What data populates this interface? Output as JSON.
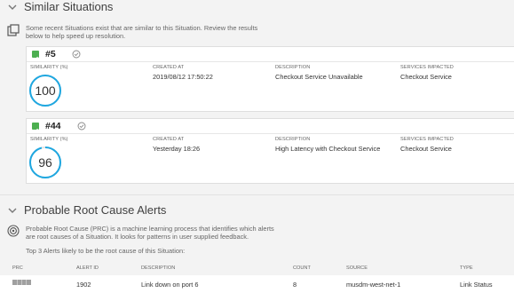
{
  "similar": {
    "title": "Similar Situations",
    "desc_line1": "Some recent Situations exist that are similar to this Situation. Review the results",
    "desc_line2": "below to help speed up resolution.",
    "columns": {
      "similarity": "SIMILARITY (%)",
      "created": "CREATED AT",
      "description": "DESCRIPTION",
      "services": "SERVICES IMPACTED"
    },
    "cards": [
      {
        "number": "#5",
        "similarity": "100",
        "similarity_fraction": 1.0,
        "created": "2019/08/12 17:50:22",
        "description": "Checkout Service Unavailable",
        "services": "Checkout Service"
      },
      {
        "number": "#44",
        "similarity": "96",
        "similarity_fraction": 0.96,
        "created": "Yesterday 18:26",
        "description": "High Latency with Checkout Service",
        "services": "Checkout Service"
      }
    ]
  },
  "prc": {
    "title": "Probable Root Cause Alerts",
    "desc_line1": "Probable Root Cause (PRC) is a machine learning process that identifies which alerts",
    "desc_line2": "are root causes of a Situation. It looks for patterns in user supplied feedback.",
    "top_text": "Top 3 Alerts likely to be the root cause of this Situation:",
    "columns": {
      "prc": "PRC",
      "alert_id": "ALERT ID",
      "description": "DESCRIPTION",
      "count": "COUNT",
      "source": "SOURCE",
      "type": "TYPE"
    },
    "rows": [
      {
        "alert_id": "1902",
        "description": "Link down on port 6",
        "count": "8",
        "source": "musdm-west-net-1",
        "type": "Link Status"
      }
    ]
  },
  "colors": {
    "ring": "#1ea7e0",
    "checkbox": "#4caf50",
    "background": "#f3f3f3"
  },
  "icons": [
    "chevron-down-icon",
    "copy-icon",
    "check-circle-icon",
    "radar-icon"
  ]
}
